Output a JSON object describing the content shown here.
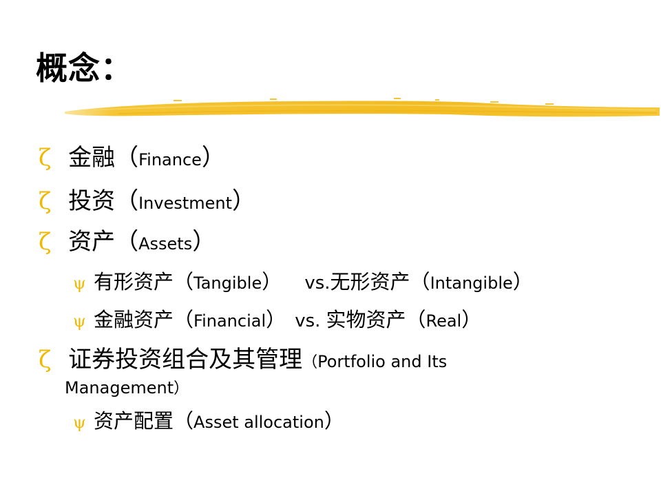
{
  "slide": {
    "title": "概念：",
    "accent_color": "#f0b800",
    "bullet_icons": {
      "level1": "ζ",
      "level2": "ψ"
    },
    "items": [
      {
        "level": 1,
        "zh": "金融",
        "open": "（",
        "en": "Finance",
        "close": "）"
      },
      {
        "level": 1,
        "zh": "投资",
        "open": "（",
        "en": "Investment",
        "close": "）"
      },
      {
        "level": 1,
        "zh": "资产",
        "open": "（",
        "en": "Assets",
        "close": "）"
      },
      {
        "level": 2,
        "zh": "有形资产",
        "open": "（",
        "en": "Tangible",
        "close": "）",
        "vs": "vs.",
        "zh2": "无形资产",
        "open2": "（",
        "en2": "Intangible",
        "close2": "）"
      },
      {
        "level": 2,
        "zh": "金融资产",
        "open": "（",
        "en": "Financial",
        "close": "）",
        "vs": "vs.",
        "zh2": "实物资产",
        "open2": "（",
        "en2": "Real",
        "close2": "）"
      },
      {
        "level": 1,
        "zh": "证券投资组合及其管理",
        "open": "（",
        "en": "Portfolio and Its",
        "en_cont": "Management",
        "close": "）"
      },
      {
        "level": 2,
        "zh": "资产配置",
        "open": "（",
        "en": "Asset allocation",
        "close": "）"
      }
    ]
  }
}
